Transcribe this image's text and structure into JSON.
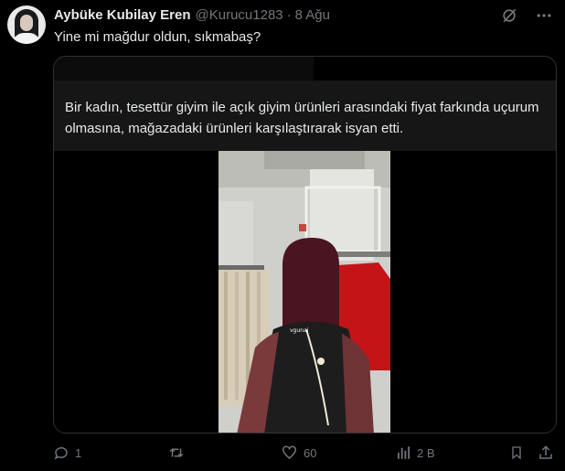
{
  "author": {
    "name": "Aybüke Kubilay Eren",
    "handle": "@Kurucu1283",
    "separator": "·",
    "time": "8 Ağu",
    "avatar_icon": "profile-avatar"
  },
  "tweet": {
    "text": "Yine mi mağdur oldun, sıkmabaş?"
  },
  "quote": {
    "text": "Bir kadın, tesettür giyim ile açık giyim ürünleri arasındaki fiyat farkında uçurum olmasına, mağazadaki ürünleri karşılaştırarak isyan etti.",
    "video_label": "vgunai"
  },
  "top_icons": [
    "grok-icon",
    "more-icon"
  ],
  "actions": {
    "reply_count": "1",
    "retweet_count": "",
    "like_count": "60",
    "views_count": "2 B",
    "bookmark_count": "",
    "share_count": ""
  },
  "colors": {
    "background": "#000000",
    "text_primary": "#e7e9ea",
    "text_secondary": "#71767b",
    "border": "#2f3336"
  }
}
